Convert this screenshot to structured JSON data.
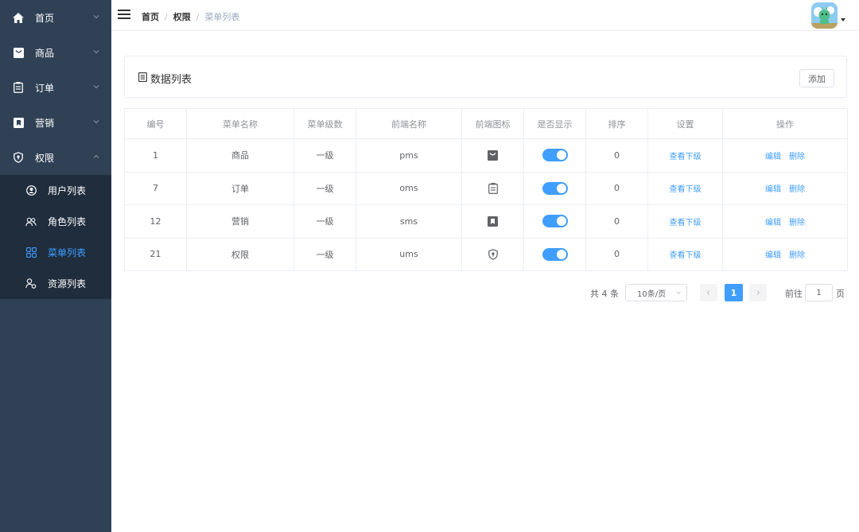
{
  "sidebar": {
    "items": [
      {
        "label": "首页"
      },
      {
        "label": "商品"
      },
      {
        "label": "订单"
      },
      {
        "label": "营销"
      },
      {
        "label": "权限"
      }
    ],
    "sub_items": [
      {
        "label": "用户列表"
      },
      {
        "label": "角色列表"
      },
      {
        "label": "菜单列表"
      },
      {
        "label": "资源列表"
      }
    ],
    "active_sub": "菜单列表"
  },
  "header": {
    "breadcrumb": [
      "首页",
      "权限",
      "菜单列表"
    ],
    "separator": "/"
  },
  "panel": {
    "title": "数据列表",
    "add_label": "添加"
  },
  "table": {
    "headers": [
      "编号",
      "菜单名称",
      "菜单级数",
      "前端名称",
      "前端图标",
      "是否显示",
      "排序",
      "设置",
      "操作"
    ],
    "rows": [
      {
        "id": "1",
        "name": "商品",
        "level": "一级",
        "frontend": "pms",
        "icon": "product-icon",
        "shown": true,
        "sort": "0",
        "setting": "查看下级",
        "edit": "编辑",
        "delete": "删除"
      },
      {
        "id": "7",
        "name": "订单",
        "level": "一级",
        "frontend": "oms",
        "icon": "order-icon",
        "shown": true,
        "sort": "0",
        "setting": "查看下级",
        "edit": "编辑",
        "delete": "删除"
      },
      {
        "id": "12",
        "name": "营销",
        "level": "一级",
        "frontend": "sms",
        "icon": "marketing-icon",
        "shown": true,
        "sort": "0",
        "setting": "查看下级",
        "edit": "编辑",
        "delete": "删除"
      },
      {
        "id": "21",
        "name": "权限",
        "level": "一级",
        "frontend": "ums",
        "icon": "permission-icon",
        "shown": true,
        "sort": "0",
        "setting": "查看下级",
        "edit": "编辑",
        "delete": "删除"
      }
    ]
  },
  "pagination": {
    "total_text": "共 4 条",
    "page_size": "10条/页",
    "current_page": "1",
    "goto_label": "前往",
    "goto_value": "1",
    "page_unit": "页"
  },
  "colors": {
    "sidebar_bg": "#304156",
    "submenu_bg": "#1f2d3d",
    "accent": "#409eff"
  }
}
